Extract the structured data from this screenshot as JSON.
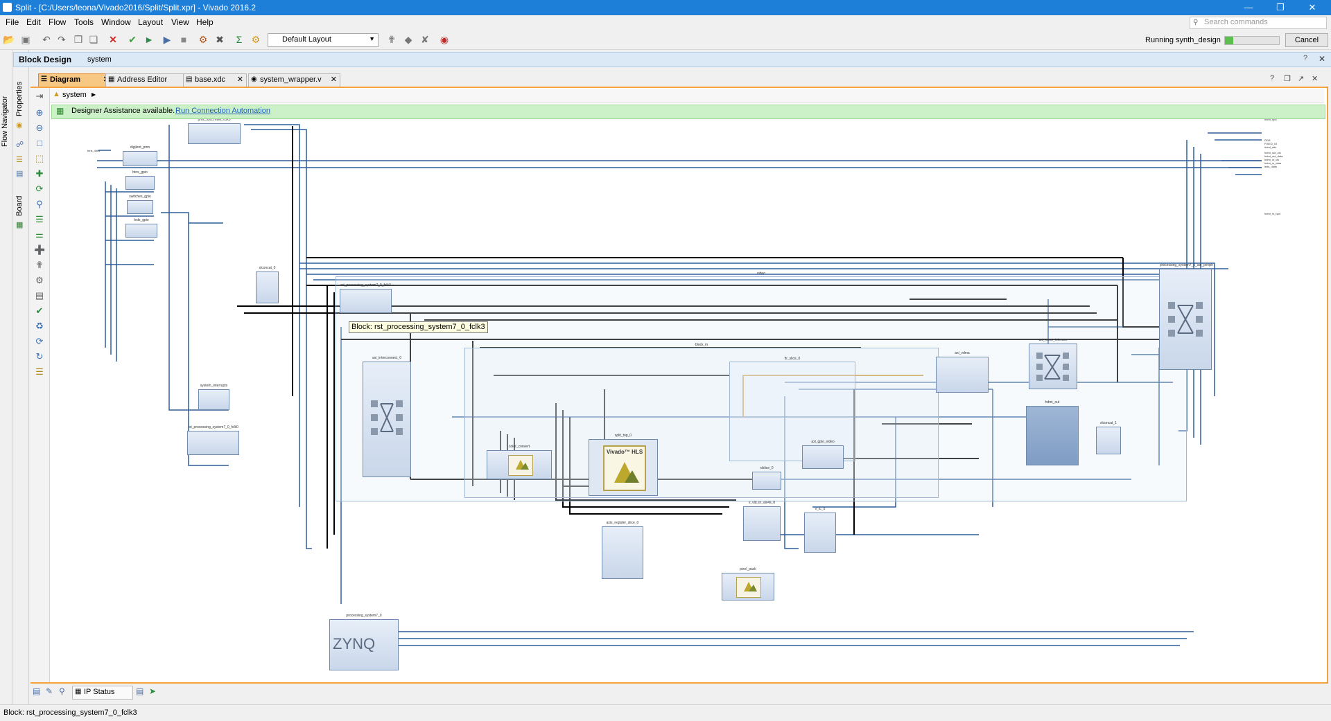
{
  "window": {
    "title": "Split - [C:/Users/leona/Vivado2016/Split/Split.xpr] - Vivado 2016.2",
    "controls": [
      "—",
      "❐",
      "✕"
    ]
  },
  "menubar": {
    "items": [
      "File",
      "Edit",
      "Flow",
      "Tools",
      "Window",
      "Layout",
      "View",
      "Help"
    ],
    "search_placeholder": "Search commands"
  },
  "toolbar": {
    "layout_select": "Default Layout",
    "status": "Running synth_design",
    "progress": 0.15,
    "cancel_label": "Cancel"
  },
  "left_tabs": [
    "Flow Navigator",
    "Properties",
    "Board"
  ],
  "block_design": {
    "title": "Block Design",
    "design_name": "system",
    "header_controls": [
      "?",
      "✕"
    ]
  },
  "tabs": [
    {
      "label": "Diagram",
      "active": true
    },
    {
      "label": "Address Editor",
      "active": false
    },
    {
      "label": "base.xdc",
      "active": false
    },
    {
      "label": "system_wrapper.v",
      "active": false
    }
  ],
  "breadcrumb": "system",
  "assistance": {
    "text": "Designer Assistance available.",
    "link": "Run Connection Automation"
  },
  "diagram": {
    "tooltip": "Block: rst_processing_system7_0_fclk3",
    "hls_label": "Vivado™ HLS",
    "zynq_label": "ZYNQ"
  },
  "bottom": {
    "ip_status": "IP Status"
  },
  "statusbar": {
    "text": "Block: rst_processing_system7_0_fclk3"
  }
}
